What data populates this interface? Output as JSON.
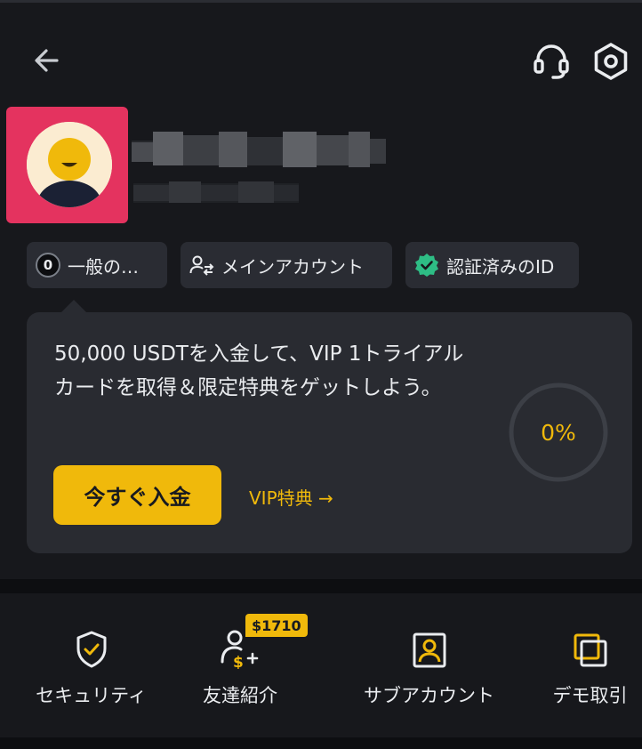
{
  "header": {
    "back_icon": "arrow-left-icon",
    "support_icon": "headset-icon",
    "settings_icon": "settings-hexagon-icon"
  },
  "profile": {
    "avatar_icon": "user-avatar-icon",
    "name_obscured": true
  },
  "chips": {
    "level_badge": "0",
    "level_label": "一般の…",
    "account_label": "メインアカウント",
    "verified_label": "認証済みのID"
  },
  "promo": {
    "text": "50,000 USDTを入金して、VIP 1トライアルカードを取得＆限定特典をゲットしよう。",
    "deposit_button": "今すぐ入金",
    "vip_link": "VIP特典 →",
    "progress_label": "0%",
    "progress_value": 0
  },
  "shortcuts": [
    {
      "label": "セキュリティ",
      "icon": "shield-check-icon"
    },
    {
      "label": "友達紹介",
      "icon": "referral-user-icon",
      "badge": "$1710"
    },
    {
      "label": "サブアカウント",
      "icon": "sub-account-icon"
    },
    {
      "label": "デモ取引",
      "icon": "demo-trading-icon"
    }
  ],
  "colors": {
    "background": "#17181c",
    "card": "#292b31",
    "accent": "#f0b90b",
    "highlight_frame": "#e4335f",
    "verified_green": "#2ebd85"
  }
}
